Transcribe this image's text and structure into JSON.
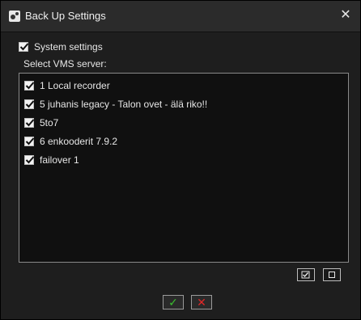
{
  "window": {
    "title": "Back Up Settings",
    "close_glyph": "✕",
    "title_icon": "gear-settings-icon"
  },
  "system_settings": {
    "label": "System settings",
    "checked": true
  },
  "server_list": {
    "label": "Select VMS server:",
    "items": [
      {
        "label": "1  Local recorder",
        "checked": true
      },
      {
        "label": "5  juhanis legacy - Talon ovet - älä riko!!",
        "checked": true
      },
      {
        "label": "5to7",
        "checked": true
      },
      {
        "label": "6  enkooderit 7.9.2",
        "checked": true
      },
      {
        "label": "failover 1",
        "checked": true
      }
    ]
  },
  "list_controls": {
    "select_all_icon": "check-all-icon",
    "deselect_all_icon": "uncheck-all-icon"
  },
  "actions": {
    "ok_glyph": "✓",
    "cancel_glyph": "✕",
    "ok_color": "#3bbf2f",
    "cancel_color": "#e02828"
  }
}
